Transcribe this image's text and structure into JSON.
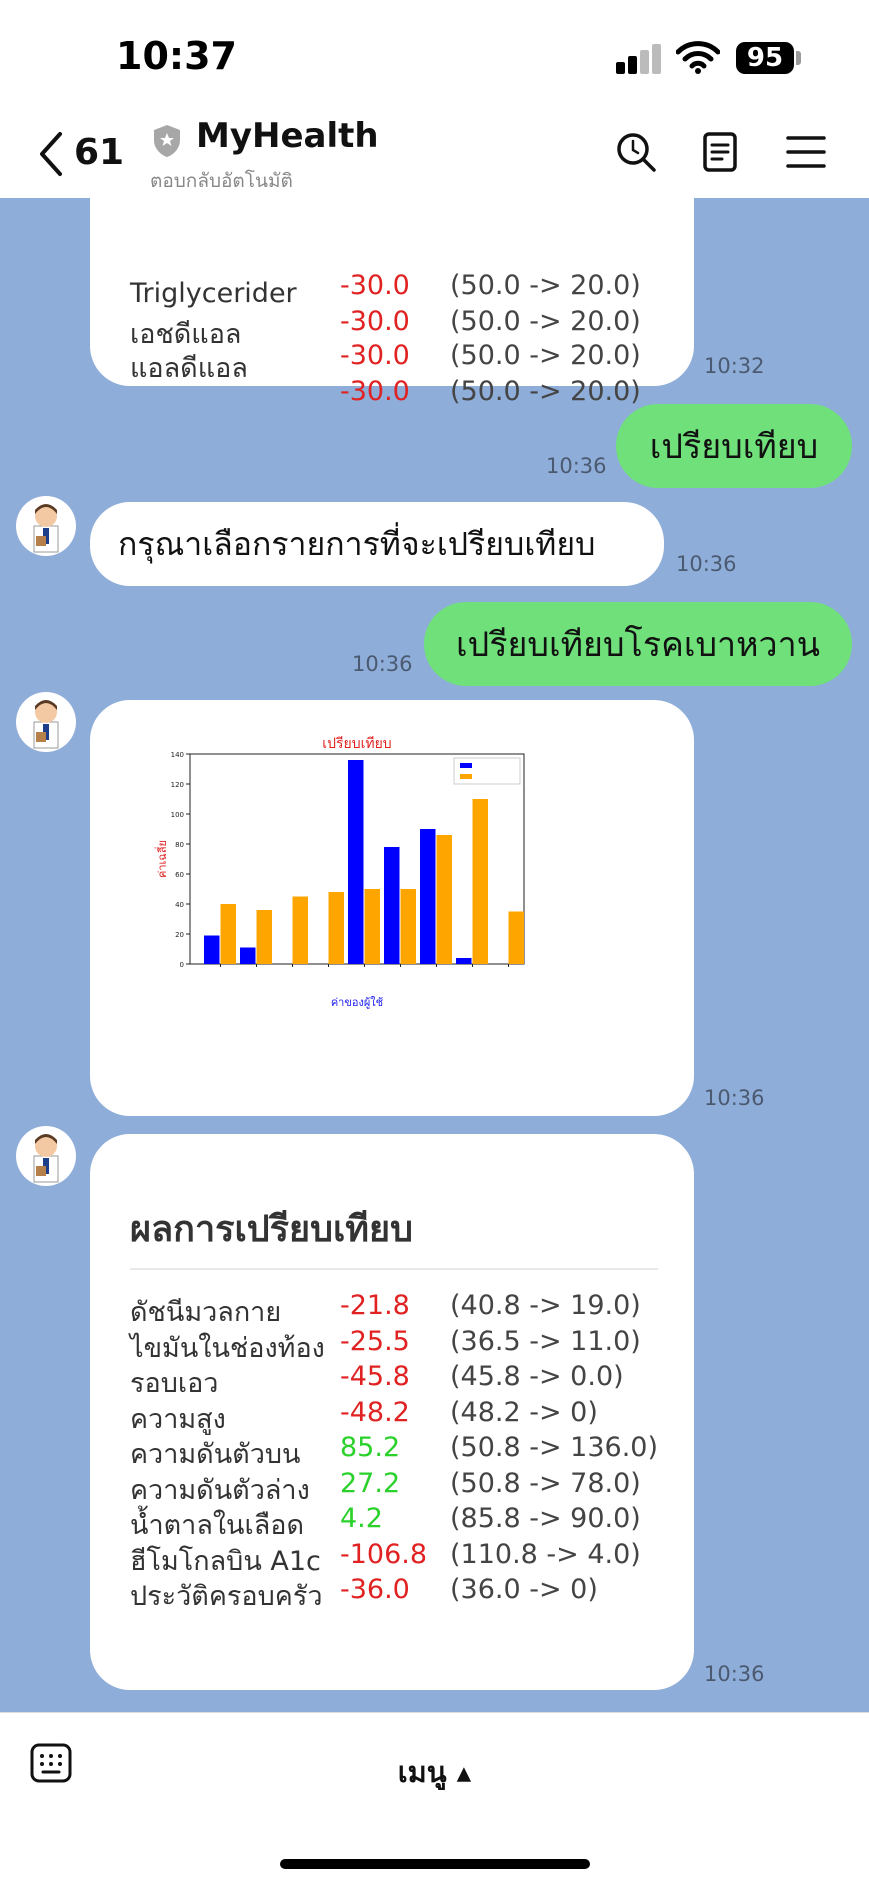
{
  "status": {
    "time": "10:37",
    "battery": "95"
  },
  "header": {
    "back_count": "61",
    "title": "MyHealth",
    "subtitle": "ตอบกลับอัตโนมัติ"
  },
  "messages": {
    "prev_card": {
      "rows": [
        {
          "label": "Triglycerider",
          "diff": "-30.0",
          "range": "(50.0 -> 20.0)"
        },
        {
          "label": "เอชดีแอล",
          "diff": "-30.0",
          "range": "(50.0 -> 20.0)"
        },
        {
          "label": "แอลดีแอล",
          "diff": "-30.0",
          "range": "(50.0 -> 20.0)"
        },
        {
          "label": "",
          "diff": "-30.0",
          "range": "(50.0 -> 20.0)"
        }
      ],
      "time": "10:32"
    },
    "user_compare": {
      "text": "เปรียบเทียบ",
      "time": "10:36"
    },
    "bot_prompt": {
      "text": "กรุณาเลือกรายการที่จะเปรียบเทียบ",
      "time": "10:36"
    },
    "user_diabetes": {
      "text": "เปรียบเทียบโรคเบาหวาน",
      "time": "10:36"
    },
    "chart_time": "10:36",
    "result": {
      "title": "ผลการเปรียบเทียบ",
      "time": "10:36",
      "rows": [
        {
          "label": "ดัชนีมวลกาย",
          "diff": "-21.8",
          "range": "(40.8 -> 19.0)",
          "sign": "neg"
        },
        {
          "label": "ไขมันในช่องท้อง",
          "diff": "-25.5",
          "range": "(36.5 -> 11.0)",
          "sign": "neg"
        },
        {
          "label": "รอบเอว",
          "diff": "-45.8",
          "range": "(45.8 -> 0.0)",
          "sign": "neg"
        },
        {
          "label": "ความสูง",
          "diff": "-48.2",
          "range": "(48.2 -> 0)",
          "sign": "neg"
        },
        {
          "label": "ความดันตัวบน",
          "diff": "85.2",
          "range": "(50.8 -> 136.0)",
          "sign": "pos"
        },
        {
          "label": "ความดันตัวล่าง",
          "diff": "27.2",
          "range": "(50.8 -> 78.0)",
          "sign": "pos"
        },
        {
          "label": "น้ำตาลในเลือด",
          "diff": "4.2",
          "range": "(85.8 -> 90.0)",
          "sign": "pos"
        },
        {
          "label": "ฮีโมโกลบิน A1c",
          "diff": "-106.8",
          "range": "(110.8 -> 4.0)",
          "sign": "neg"
        },
        {
          "label": "ประวัติครอบครัว",
          "diff": "-36.0",
          "range": "(36.0 -> 0)",
          "sign": "neg"
        }
      ]
    }
  },
  "chart_data": {
    "type": "bar",
    "title": "เปรียบเทียบ",
    "xlabel": "ค่าของผู้ใช้",
    "ylabel": "ค่าเฉลี่ย",
    "ylim": [
      0,
      140
    ],
    "yticks": [
      0,
      20,
      40,
      60,
      80,
      100,
      120,
      140
    ],
    "categories": [
      "",
      "",
      "",
      "",
      "",
      "",
      "",
      "",
      ""
    ],
    "series": [
      {
        "name": "",
        "color": "#0000ff",
        "values": [
          19,
          11,
          0,
          0,
          136,
          78,
          90,
          4,
          0
        ]
      },
      {
        "name": "",
        "color": "#ffa500",
        "values": [
          40,
          36,
          45,
          48,
          50,
          50,
          86,
          110,
          35
        ]
      }
    ],
    "legend": "top-right",
    "title_color": "#e02222",
    "xlabel_color": "#2222ee",
    "ylabel_color": "#e02222"
  },
  "bottom": {
    "menu_label": "เมนู ▴"
  },
  "icons": {
    "back": "chevron-left-icon",
    "shield": "shield-icon",
    "search": "search-icon",
    "notes": "notes-icon",
    "menu": "hamburger-icon",
    "keyboard": "keyboard-icon",
    "avatar": "doctor-avatar"
  }
}
